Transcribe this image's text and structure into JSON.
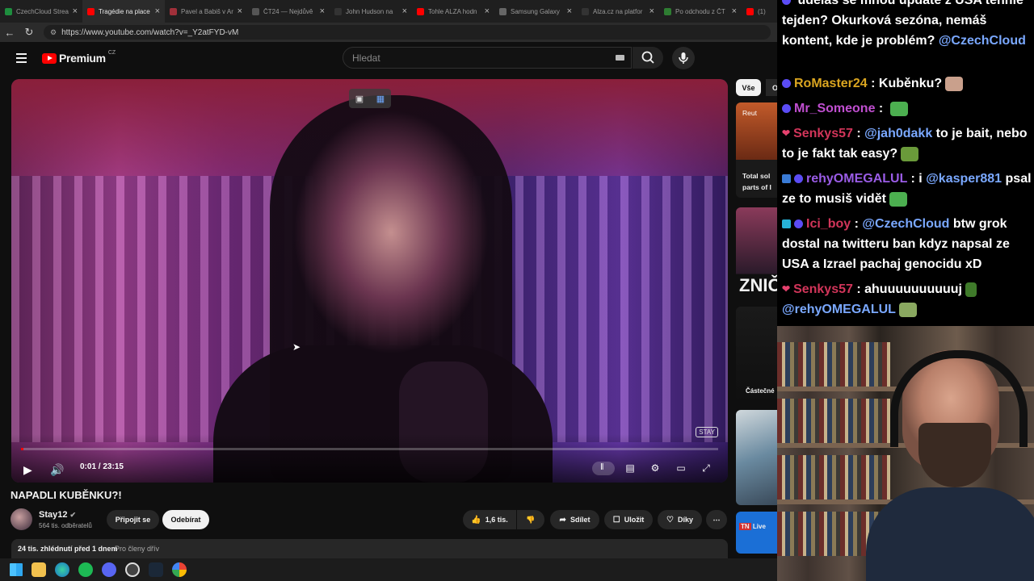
{
  "browser": {
    "tabs": [
      {
        "title": "CzechCloud Strea",
        "color": "#1e8e3e"
      },
      {
        "title": "Tragédie na place",
        "color": "#ff0000",
        "active": true
      },
      {
        "title": "Pavel a Babiš v Ar",
        "color": "#a0303a"
      },
      {
        "title": "ČT24 — Nejdůvě",
        "color": "#555555"
      },
      {
        "title": "John Hudson na ",
        "color": "#333333"
      },
      {
        "title": "Tohle ALZA hodn",
        "color": "#ff0000"
      },
      {
        "title": "Samsung Galaxy",
        "color": "#666666"
      },
      {
        "title": "Alza.cz na platfor",
        "color": "#333333"
      },
      {
        "title": "Po odchodu z ČT",
        "color": "#2e7d32"
      },
      {
        "title": "(1)",
        "color": "#ff0000"
      }
    ],
    "url": "https://www.youtube.com/watch?v=_Y2atFYD-vM"
  },
  "header": {
    "logo_text": "Premium",
    "region": "CZ",
    "search_placeholder": "Hledat"
  },
  "player": {
    "current_time": "0:01",
    "duration": "23:15",
    "time_separator": "/",
    "progress": 0.001,
    "watermark": "STAY"
  },
  "video": {
    "title": "NAPADLI KUBĚNKU?!",
    "channel": "Stay12",
    "subscribers": "564 tis. odběratelů",
    "join_label": "Připojit se",
    "subscribe_label": "Odebírat",
    "likes": "1,6 tis.",
    "share_label": "Sdílet",
    "save_label": "Uložit",
    "thanks_label": "Díky",
    "views_meta": "24 tis. zhlédnutí  před 1 dnem",
    "members_meta": "Pro členy dřív"
  },
  "sidebar": {
    "chip_all": "Vše",
    "chip_next": "O",
    "thumbs": [
      {
        "caption1": "Reut",
        "caption2": "Total sol",
        "caption3": "parts of I"
      },
      {
        "caption1": "ZNIČ"
      },
      {
        "caption1": "Částečné"
      },
      {
        "caption1": ""
      },
      {
        "caption1": "Live"
      }
    ]
  },
  "chat": {
    "messages": [
      {
        "user": "",
        "color": "#ffffff",
        "text": "uděláš se mnou update z USA tenhle tejden? Okurková sezóna, nemáš kontent, kde je problém?",
        "mention": "@CzechCloud"
      },
      {
        "user": "RoMaster24",
        "color": "#daa520",
        "text": "Kuběnku?"
      },
      {
        "user": "Mr_Someone",
        "color": "#c04fd0",
        "text": ""
      },
      {
        "user": "Senkys57",
        "color": "#d2355a",
        "mention": "@jah0dakk",
        "text": "to je bait, nebo to je fakt tak easy?"
      },
      {
        "user": "rehyOMEGALUL",
        "color": "#9a5ce6",
        "pre": "i",
        "mention": "@kasper881",
        "text": "psal ze to musiš vidět"
      },
      {
        "user": "Ici_boy",
        "color": "#d2355a",
        "mention": "@CzechCloud",
        "text": "btw grok dostal na twitteru ban kdyz napsal ze USA a Izrael pachaj genocidu xD"
      },
      {
        "user": "Senkys57",
        "color": "#d2355a",
        "text": "ahuuuuuuuuuuj",
        "mention2": "@rehyOMEGALUL"
      }
    ]
  }
}
